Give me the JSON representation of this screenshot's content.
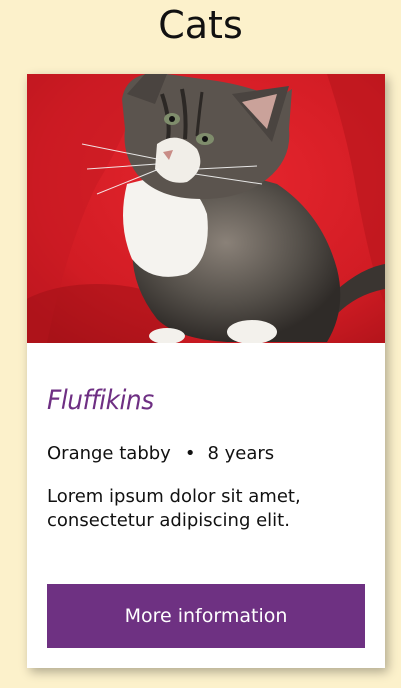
{
  "page": {
    "title": "Cats"
  },
  "card": {
    "image_alt": "Tabby kitten sitting on a red couch",
    "name": "Fluffikins",
    "breed": "Orange tabby",
    "separator": "•",
    "age": "8 years",
    "description": "Lorem ipsum dolor sit amet, consectetur adipiscing elit.",
    "button_label": "More information"
  },
  "colors": {
    "background": "#fcf1cb",
    "accent": "#6e3182",
    "card": "#ffffff"
  }
}
